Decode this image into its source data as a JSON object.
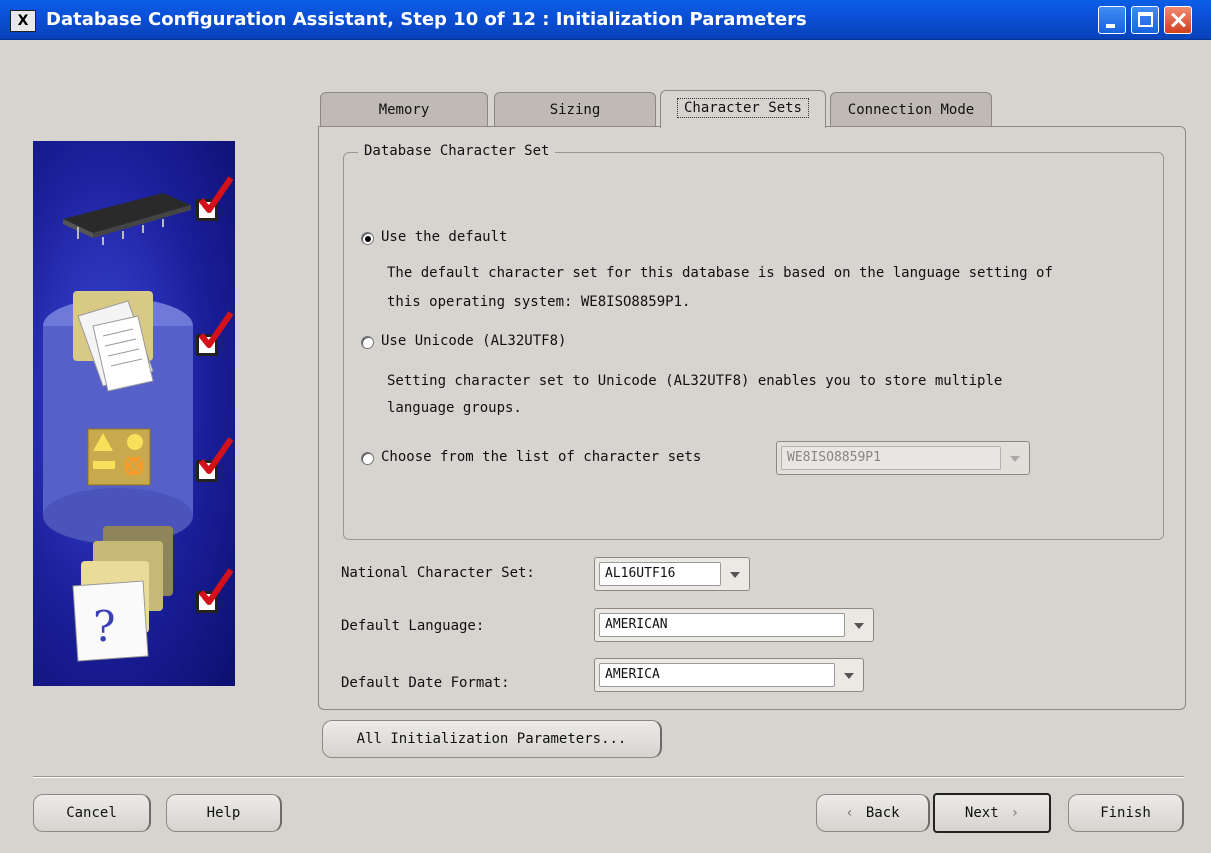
{
  "window": {
    "title": "Database Configuration Assistant, Step 10 of 12 : Initialization Parameters",
    "icon_letter": "X"
  },
  "tabs": [
    {
      "label": "Memory",
      "active": false
    },
    {
      "label": "Sizing",
      "active": false
    },
    {
      "label": "Character Sets",
      "active": true
    },
    {
      "label": "Connection Mode",
      "active": false
    }
  ],
  "charset_group": {
    "title": "Database Character Set",
    "option_default": {
      "label": "Use the default",
      "selected": true,
      "desc_line1": "The default character set for this database is based on the language setting of",
      "desc_line2": "this operating system: WE8ISO8859P1."
    },
    "option_unicode": {
      "label": "Use Unicode (AL32UTF8)",
      "selected": false,
      "desc_line1": "Setting character set to Unicode (AL32UTF8) enables you to store multiple",
      "desc_line2": "language groups."
    },
    "option_list": {
      "label": "Choose from the list of character sets",
      "selected": false,
      "value": "WE8ISO8859P1"
    }
  },
  "fields": {
    "national_label": "National Character Set:",
    "national_value": "AL16UTF16",
    "language_label": "Default Language:",
    "language_value": "AMERICAN",
    "date_label": "Default Date Format:",
    "date_value": "AMERICA"
  },
  "buttons": {
    "all_params": "All Initialization Parameters...",
    "cancel": "Cancel",
    "help": "Help",
    "back": "Back",
    "next": "Next",
    "finish": "Finish"
  },
  "icons": {
    "back_arrow": "back-chevron-icon",
    "next_arrow": "next-chevron-icon",
    "steps": [
      "memory-chip-icon",
      "document-folder-icon",
      "shapes-icon",
      "help-document-icon"
    ]
  },
  "colors": {
    "title_bar": "#0b50d8",
    "side_panel": "#1b1f9a",
    "check_mark": "#d4111a"
  }
}
